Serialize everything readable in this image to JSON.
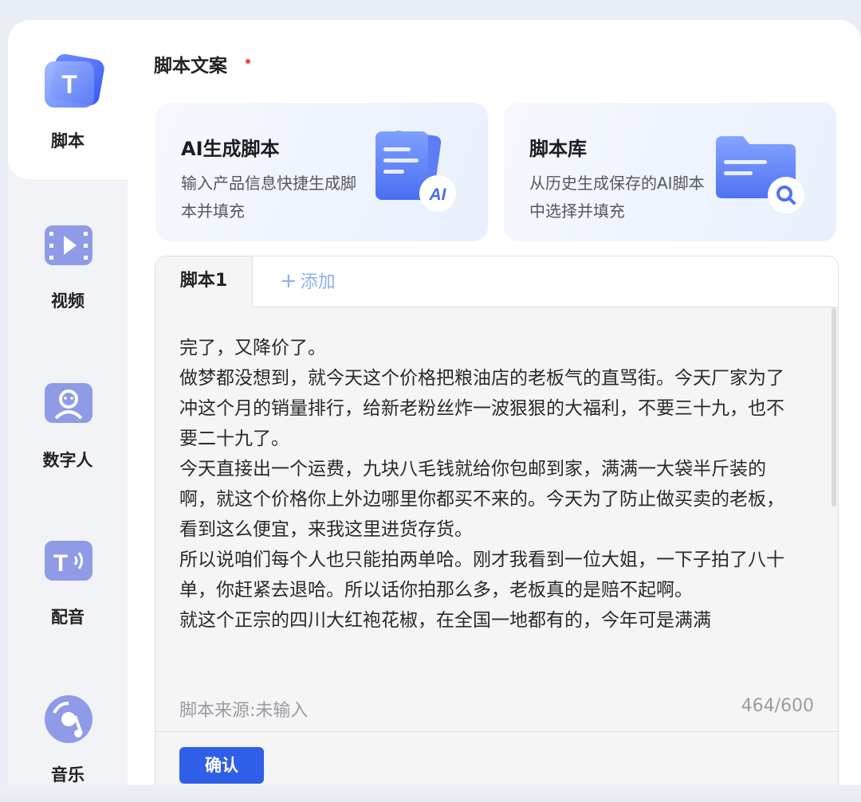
{
  "sidebar": {
    "items": [
      {
        "label": "脚本",
        "icon": "script-icon",
        "active": true
      },
      {
        "label": "视频",
        "icon": "video-icon",
        "active": false
      },
      {
        "label": "数字人",
        "icon": "digital-human-icon",
        "active": false
      },
      {
        "label": "配音",
        "icon": "voiceover-icon",
        "active": false
      },
      {
        "label": "音乐",
        "icon": "music-icon",
        "active": false
      }
    ]
  },
  "main": {
    "section_title": "脚本文案",
    "cards": [
      {
        "title": "AI生成脚本",
        "desc": "输入产品信息快捷生成脚本并填充",
        "icon": "ai-document-icon",
        "badge": "AI"
      },
      {
        "title": "脚本库",
        "desc": "从历史生成保存的AI脚本中选择并填充",
        "icon": "folder-search-icon"
      }
    ],
    "tabs": [
      {
        "label": "脚本1",
        "active": true
      }
    ],
    "add_tab_label": "添加",
    "script_lines": [
      "完了，又降价了。",
      "做梦都没想到，就今天这个价格把粮油店的老板气的直骂街。今天厂家为了冲这个月的销量排行，给新老粉丝炸一波狠狠的大福利，不要三十九，也不要二十九了。",
      "今天直接出一个运费，九块八毛钱就给你包邮到家，满满一大袋半斤装的啊，就这个价格你上外边哪里你都买不来的。今天为了防止做买卖的老板，看到这么便宜，来我这里进货存货。",
      "所以说咱们每个人也只能拍两单哈。刚才我看到一位大姐，一下子拍了八十单，你赶紧去退哈。所以话你拍那么多，老板真的是赔不起啊。",
      "就这个正宗的四川大红袍花椒，在全国一地都有的，今年可是满满"
    ],
    "source_label": "脚本来源:未输入",
    "char_count": "464/600",
    "confirm_label": "确认"
  },
  "colors": {
    "accent": "#2f5fe8",
    "required_dot": "#f0474a",
    "sidebar_icon": "#8f9be6"
  }
}
